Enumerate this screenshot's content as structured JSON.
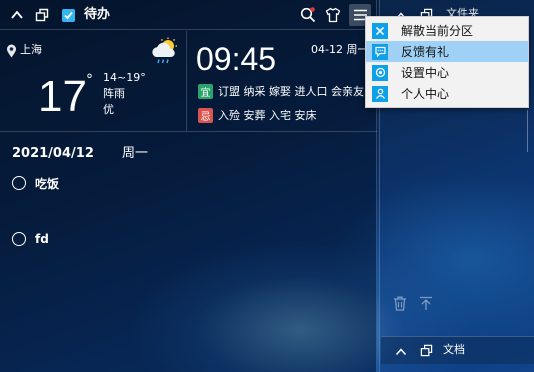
{
  "header": {
    "title": "待办"
  },
  "weather": {
    "city": "上海",
    "temperature": "17",
    "unit": "°",
    "range": "14~19°",
    "condition": "阵雨",
    "air_quality": "优"
  },
  "clock": {
    "time": "09:45",
    "date": "04-12 周一"
  },
  "almanac": {
    "good_tag": "宜",
    "good": "订盟 纳采 嫁娶 进人口 会亲友",
    "bad_tag": "忌",
    "bad": "入殓 安葬 入宅 安床"
  },
  "todo": {
    "date": "2021/04/12",
    "weekday": "周一",
    "items": [
      {
        "label": "吃饭"
      },
      {
        "label": "fd"
      }
    ]
  },
  "file_panel": {
    "title": "文件夹"
  },
  "doc_panel": {
    "title": "文档"
  },
  "menu": {
    "items": [
      {
        "label": "解散当前分区",
        "icon": "close-x-icon"
      },
      {
        "label": "反馈有礼",
        "icon": "chat-bubble-icon"
      },
      {
        "label": "设置中心",
        "icon": "settings-icon"
      },
      {
        "label": "个人中心",
        "icon": "user-icon"
      }
    ],
    "active_index": 1
  },
  "colors": {
    "good_tag": "#2ca36b",
    "bad_tag": "#d9534f",
    "menu_icon": "#0ea0e8",
    "menu_active": "#9fd0f5",
    "notify_dot": "#e53935"
  }
}
